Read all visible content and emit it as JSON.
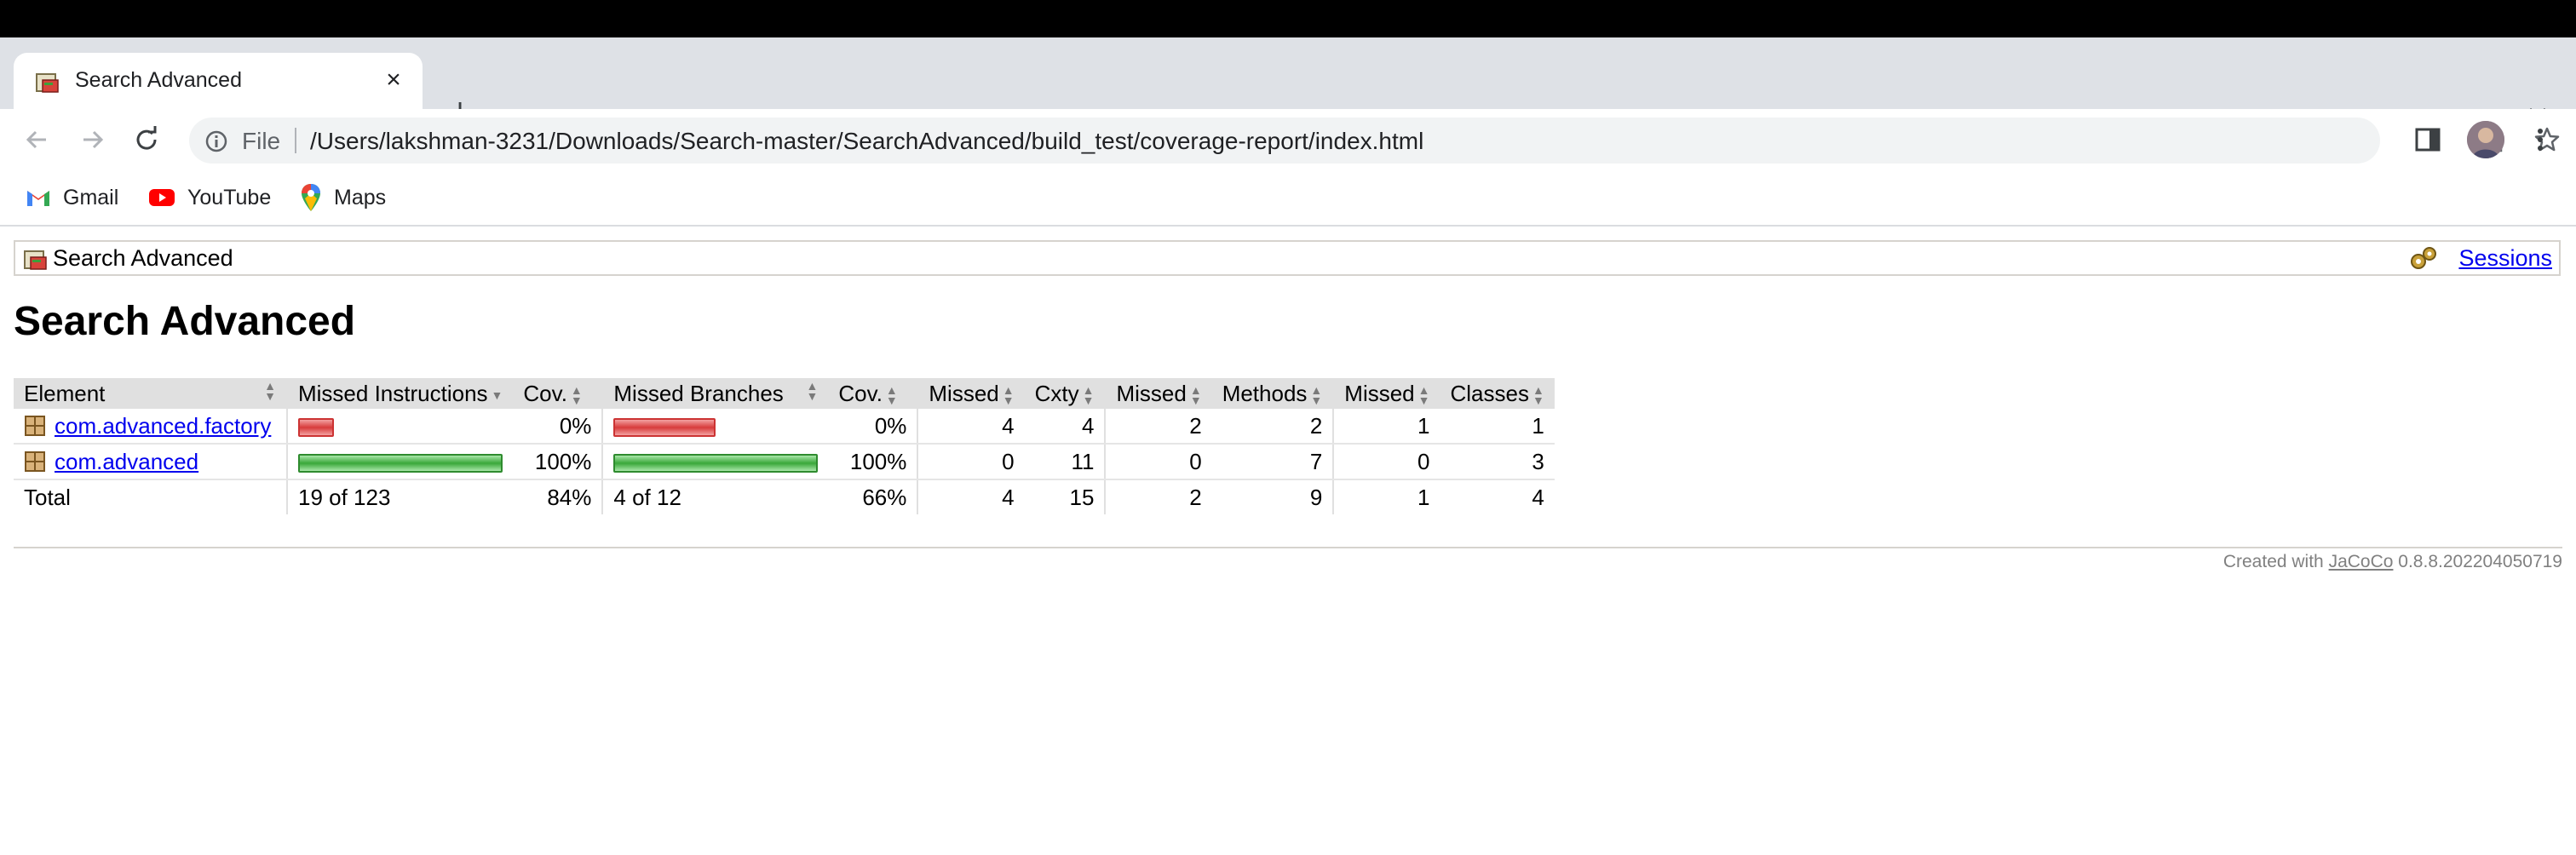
{
  "browser": {
    "tab_title": "Search Advanced",
    "new_tab_symbol": "+",
    "close_symbol": "×",
    "omnibox": {
      "scheme_label": "File",
      "url": "/Users/lakshman-3231/Downloads/Search-master/SearchAdvanced/build_test/coverage-report/index.html"
    },
    "bookmarks": [
      {
        "label": "Gmail",
        "icon": "gmail-icon"
      },
      {
        "label": "YouTube",
        "icon": "youtube-icon"
      },
      {
        "label": "Maps",
        "icon": "maps-icon"
      }
    ],
    "icons": [
      "back-icon",
      "forward-icon",
      "reload-icon",
      "info-icon",
      "share-icon",
      "star-icon",
      "side-panel-icon",
      "avatar",
      "menu-icon"
    ]
  },
  "report": {
    "breadcrumb": "Search Advanced",
    "sessions_label": "Sessions",
    "title": "Search Advanced",
    "columns": [
      "Element",
      "Missed Instructions",
      "Cov.",
      "Missed Branches",
      "Cov.",
      "Missed",
      "Cxty",
      "Missed",
      "Methods",
      "Missed",
      "Classes"
    ],
    "rows": [
      {
        "element": "com.advanced.factory",
        "missed_instructions_bar": {
          "color": "red",
          "missed_fraction": 1.0
        },
        "instr_cov": "0%",
        "missed_branches_bar": {
          "color": "red",
          "missed_fraction": 1.0
        },
        "branch_cov": "0%",
        "missed_cxty": "4",
        "cxty": "4",
        "missed_methods": "2",
        "methods": "2",
        "missed_classes": "1",
        "classes": "1"
      },
      {
        "element": "com.advanced",
        "missed_instructions_bar": {
          "color": "green",
          "covered_fraction": 1.0
        },
        "instr_cov": "100%",
        "missed_branches_bar": {
          "color": "green",
          "covered_fraction": 1.0
        },
        "branch_cov": "100%",
        "missed_cxty": "0",
        "cxty": "11",
        "missed_methods": "0",
        "methods": "7",
        "missed_classes": "0",
        "classes": "3"
      }
    ],
    "total": {
      "label": "Total",
      "missed_instructions": "19 of 123",
      "instr_cov": "84%",
      "missed_branches": "4 of 12",
      "branch_cov": "66%",
      "missed_cxty": "4",
      "cxty": "15",
      "missed_methods": "2",
      "methods": "9",
      "missed_classes": "1",
      "classes": "4"
    },
    "footer": {
      "prefix": "Created with",
      "link": "JaCoCo",
      "version": "0.8.8.202204050719"
    },
    "colors": {
      "missed_bar": "#d73b3b",
      "covered_bar": "#3aa83a",
      "header_bg": "#e0e0e0",
      "link": "#0000ee"
    }
  }
}
